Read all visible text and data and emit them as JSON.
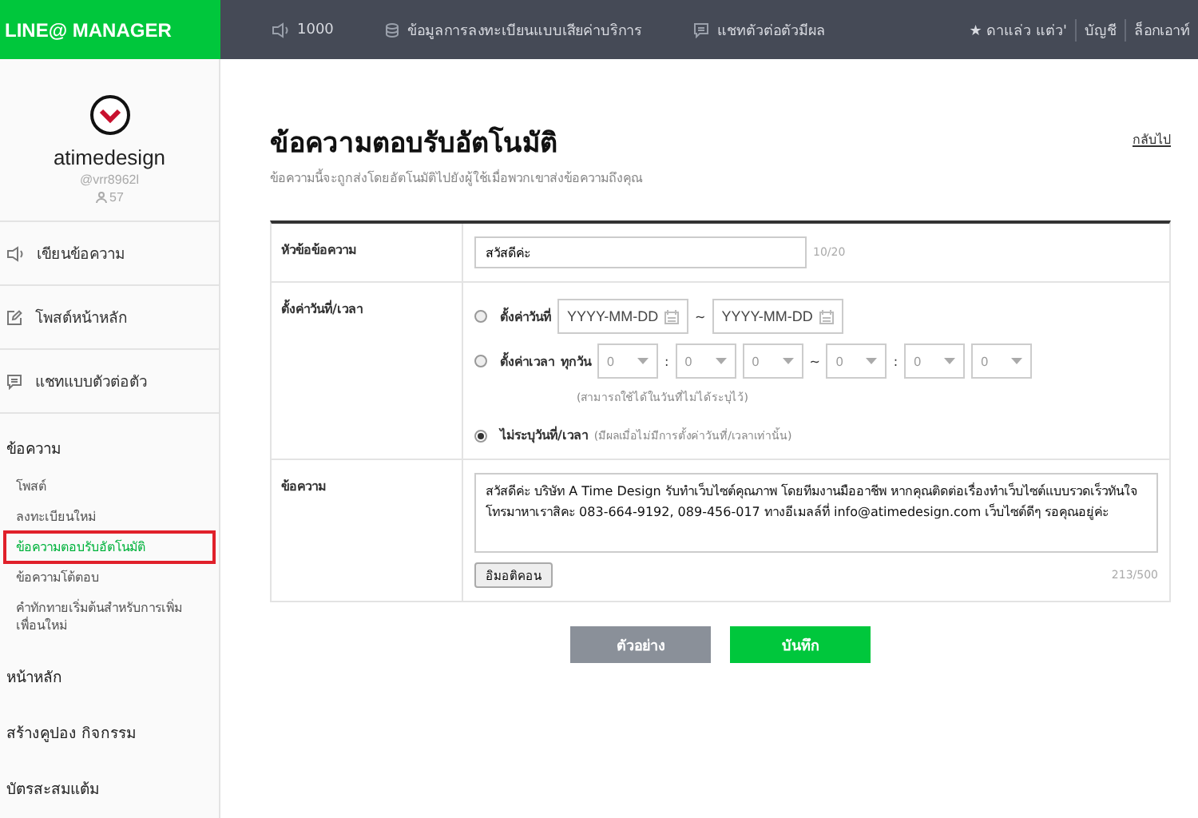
{
  "header": {
    "logo": "LINE@ MANAGER",
    "items": [
      {
        "kind": "speaker",
        "label": "1000"
      },
      {
        "kind": "database",
        "label": "ข้อมูลการลงทะเบียนแบบเสียค่าบริการ"
      },
      {
        "kind": "chat",
        "label": "แชทตัวต่อตัวมีผล"
      }
    ],
    "right": [
      "★ ดาแล่ว แต่ว'",
      "บัญชี",
      "ล็อกเอาท์"
    ]
  },
  "profile": {
    "name": "atimedesign",
    "id": "@vrr8962l",
    "followers": "57"
  },
  "menu": [
    {
      "kind": "speaker",
      "label": "เขียนข้อความ"
    },
    {
      "kind": "edit",
      "label": "โพสต์หน้าหลัก"
    },
    {
      "kind": "chat",
      "label": "แชทแบบตัวต่อตัว"
    }
  ],
  "sections": [
    {
      "title": "ข้อความ",
      "items": [
        {
          "label": "โพสต์",
          "selected": false
        },
        {
          "label": "ลงทะเบียนใหม่",
          "selected": false
        },
        {
          "label": "ข้อความตอบรับอัตโนมัติ",
          "selected": true
        },
        {
          "label": "ข้อความโต้ตอบ",
          "selected": false
        },
        {
          "label": "คำทักทายเริ่มต้นสำหรับการเพิ่มเพื่อนใหม่",
          "selected": false
        }
      ]
    },
    {
      "title": "หน้าหลัก"
    },
    {
      "title": "สร้างคูปอง กิจกรรม"
    },
    {
      "title": "บัตรสะสมแต้ม"
    }
  ],
  "page": {
    "title": "ข้อความตอบรับอัตโนมัติ",
    "subtitle": "ข้อความนี้จะถูกส่งโดยอัตโนมัติไปยังผู้ใช้เมื่อพวกเขาส่งข้อความถึงคุณ",
    "back": "กลับไป"
  },
  "form": {
    "subject": {
      "label": "หัวข้อข้อความ",
      "value": "สวัสดีค่ะ",
      "count": "10/20"
    },
    "schedule": {
      "label": "ตั้งค่าวันที่/เวลา",
      "options": [
        {
          "kind": "date",
          "label": "ตั้งค่าวันที่",
          "selected": false,
          "from": "YYYY-MM-DD",
          "to": "YYYY-MM-DD",
          "separator": "~"
        },
        {
          "kind": "time",
          "label": "ตั้งค่าเวลา",
          "selected": false,
          "every": "ทุกวัน",
          "start": [
            "0",
            "0",
            "0"
          ],
          "end": [
            "0",
            "0",
            "0"
          ],
          "separator": "~",
          "colon": ":",
          "note": "(สามารถใช้ได้ในวันที่ไม่ได้ระบุไว้)"
        },
        {
          "kind": "none",
          "label": "ไม่ระบุวันที่/เวลา",
          "selected": true,
          "note": "(มีผลเมื่อไม่มีการตั้งค่าวันที่/เวลาเท่านั้น)"
        }
      ]
    },
    "message": {
      "label": "ข้อความ",
      "value": "สวัสดีค่ะ บริษัท A Time Design รับทำเว็บไซต์คุณภาพ โดยทีมงานมืออาชีพ หากคุณติดต่อเรื่องทำเว็บไซต์แบบรวดเร็วทันใจ โทรมาหาเราสิคะ 083-664-9192, 089-456-017 ทางอีเมลล์ที่ info@atimedesign.com เว็บไซต์ดีๆ รอคุณอยู่ค่ะ",
      "emoji": "อิมอติคอน",
      "count": "213/500"
    }
  },
  "buttons": {
    "preview": "ตัวอย่าง",
    "save": "บันทึก"
  }
}
